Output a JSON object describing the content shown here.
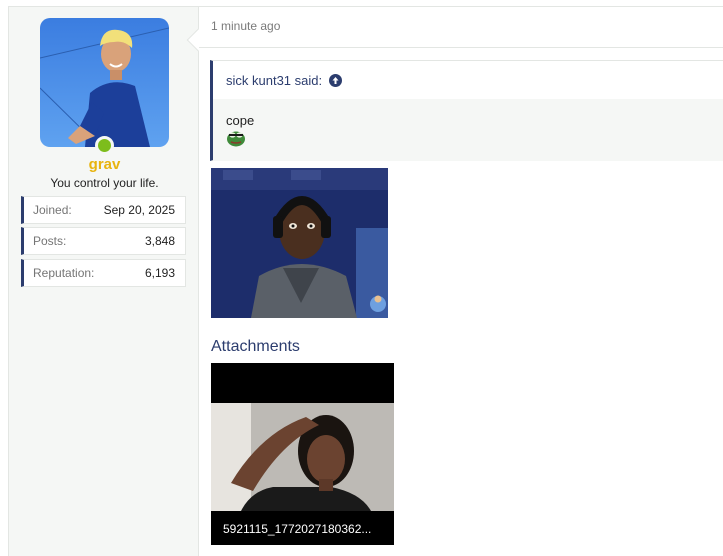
{
  "user": {
    "username": "grav",
    "title": "You control your life.",
    "online": true,
    "stats": [
      {
        "label": "Joined:",
        "value": "Sep 20, 2025"
      },
      {
        "label": "Posts:",
        "value": "3,848"
      },
      {
        "label": "Reputation:",
        "value": "6,193"
      }
    ]
  },
  "post": {
    "timestamp": "1 minute ago",
    "quote": {
      "author_line": "sick kunt31 said:",
      "text": "cope",
      "icon": "arrow-up-circle-icon"
    }
  },
  "attachments": {
    "title": "Attachments",
    "items": [
      {
        "filename": "5921115_1772027180362..."
      }
    ]
  },
  "colors": {
    "accent": "#2c3d6e",
    "username": "#e8b40f",
    "online": "#7dbd1c"
  }
}
